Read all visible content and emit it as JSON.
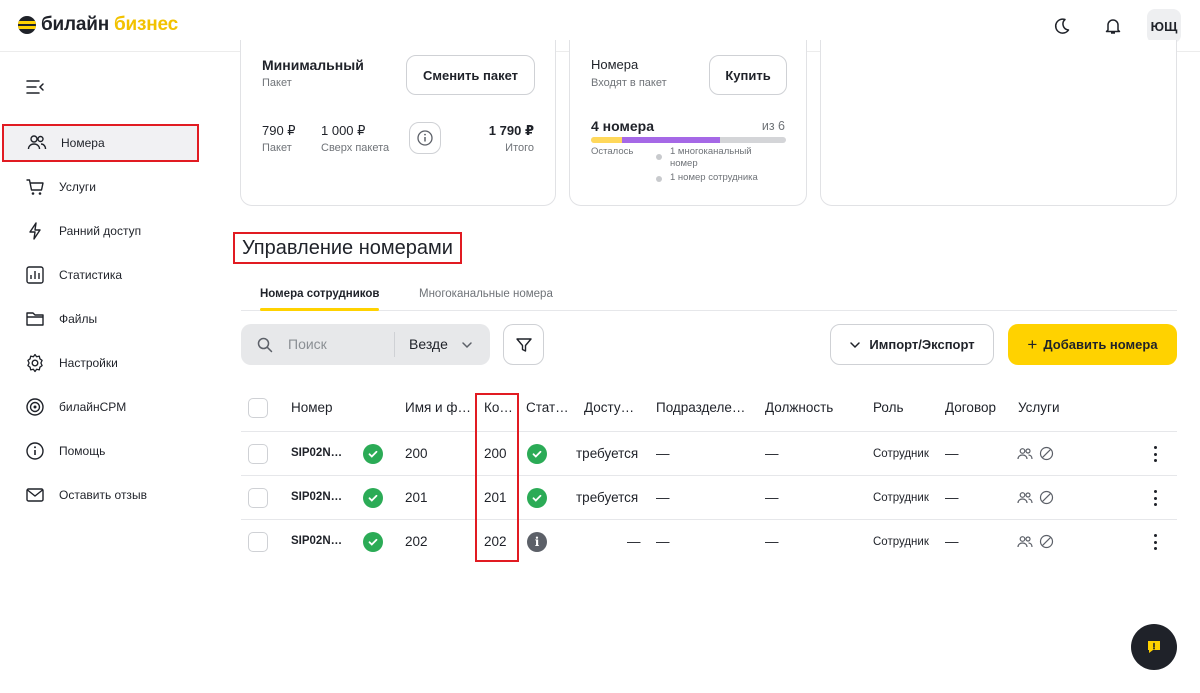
{
  "header": {
    "logo_main": "билайн",
    "logo_accent": "бизнес",
    "user_initials": "ЮЩ"
  },
  "sidebar": {
    "items": [
      {
        "label": "Номера",
        "icon": "users-icon",
        "active": true
      },
      {
        "label": "Услуги",
        "icon": "cart-icon"
      },
      {
        "label": "Ранний доступ",
        "icon": "lightning-icon"
      },
      {
        "label": "Статистика",
        "icon": "chart-icon"
      },
      {
        "label": "Файлы",
        "icon": "folder-icon"
      },
      {
        "label": "Настройки",
        "icon": "gear-icon"
      },
      {
        "label": "билайнCPM",
        "icon": "target-icon"
      },
      {
        "label": "Помощь",
        "icon": "info-icon"
      },
      {
        "label": "Оставить отзыв",
        "icon": "mail-icon"
      }
    ]
  },
  "package_card": {
    "title": "Минимальный",
    "subtitle": "Пакет",
    "change_button": "Сменить пакет",
    "price": "790 ₽",
    "price_label": "Пакет",
    "extra": "1 000 ₽",
    "extra_label": "Сверх пакета",
    "total": "1 790 ₽",
    "total_label": "Итого"
  },
  "numbers_card": {
    "title": "Номера",
    "subtitle": "Входят в пакет",
    "buy_button": "Купить",
    "count": "4 номера",
    "of_total": "из 6",
    "remaining_label": "Осталось",
    "usage": {
      "multichannel_fraction": 0.5,
      "employee_fraction": 0.16
    },
    "legend": [
      "1 многоканальный номер",
      "1 номер сотрудника"
    ]
  },
  "section": {
    "title": "Управление номерами",
    "tabs": [
      "Номера сотрудников",
      "Многоканальные номера"
    ],
    "active_tab": 0
  },
  "toolbar": {
    "search_placeholder": "Поиск",
    "scope": "Везде",
    "import_export": "Импорт/Экспорт",
    "add_numbers": "Добавить номера"
  },
  "table": {
    "headers": [
      "Номер",
      "Имя и ф…",
      "Ко…",
      "Стат…",
      "Досту…",
      "Подразделе…",
      "Должность",
      "Роль",
      "Договор",
      "Услуги"
    ],
    "rows": [
      {
        "number": "SIP02N…",
        "name": "200",
        "code": "200",
        "status": "ok",
        "access": "требуется",
        "department": "—",
        "position": "—",
        "role": "Сотрудник",
        "contract": "—"
      },
      {
        "number": "SIP02N…",
        "name": "201",
        "code": "201",
        "status": "ok",
        "access": "требуется",
        "department": "—",
        "position": "—",
        "role": "Сотрудник",
        "contract": "—"
      },
      {
        "number": "SIP02N…",
        "name": "202",
        "code": "202",
        "status": "info",
        "access": "—",
        "department": "—",
        "position": "—",
        "role": "Сотрудник",
        "contract": "—"
      }
    ]
  },
  "colors": {
    "brand_yellow": "#ffd200",
    "highlight_red": "#e11b22",
    "status_green": "#2bab56",
    "bar_purple": "#a568e6"
  }
}
